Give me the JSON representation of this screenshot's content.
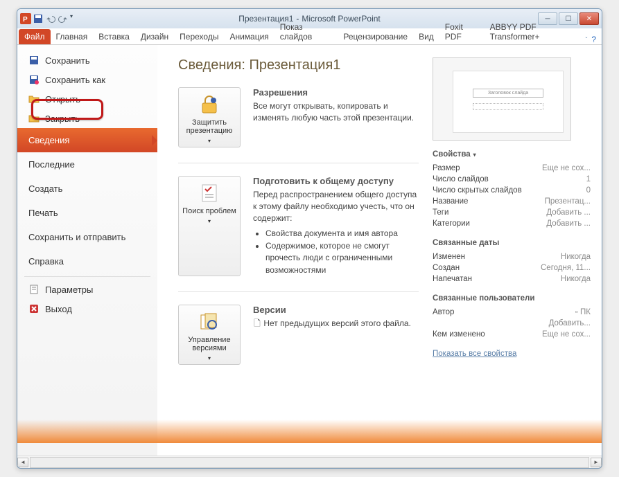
{
  "window": {
    "doc_title": "Презентация1",
    "app_title": "Microsoft PowerPoint"
  },
  "tabs": {
    "file": "Файл",
    "home": "Главная",
    "insert": "Вставка",
    "design": "Дизайн",
    "transitions": "Переходы",
    "animations": "Анимация",
    "slideshow": "Показ слайдов",
    "review": "Рецензирование",
    "view": "Вид",
    "foxit": "Foxit PDF",
    "abbyy": "ABBYY PDF Transformer+"
  },
  "sidebar": {
    "save": "Сохранить",
    "save_as": "Сохранить как",
    "open": "Открыть",
    "close": "Закрыть",
    "info": "Сведения",
    "recent": "Последние",
    "new": "Создать",
    "print": "Печать",
    "share": "Сохранить и отправить",
    "help": "Справка",
    "options": "Параметры",
    "exit": "Выход"
  },
  "info": {
    "title_prefix": "Сведения: ",
    "title_doc": "Презентация1",
    "protect_btn": "Защитить презентацию",
    "perm_h": "Разрешения",
    "perm_body": "Все могут открывать, копировать и изменять любую часть этой презентации.",
    "issues_btn": "Поиск проблем",
    "prep_h": "Подготовить к общему доступу",
    "prep_body": "Перед распространением общего доступа к этому файлу необходимо учесть, что он содержит:",
    "prep_li1": "Свойства документа и имя автора",
    "prep_li2": "Содержимое, которое не смогут прочесть люди с ограниченными возможностями",
    "versions_btn": "Управление версиями",
    "ver_h": "Версии",
    "ver_body": "Нет предыдущих версий этого файла."
  },
  "props": {
    "head": "Свойства",
    "size_k": "Размер",
    "size_v": "Еще не сох...",
    "slides_k": "Число слайдов",
    "slides_v": "1",
    "hidden_k": "Число скрытых слайдов",
    "hidden_v": "0",
    "title_k": "Название",
    "title_v": "Презентац...",
    "tags_k": "Теги",
    "tags_v": "Добавить ...",
    "cat_k": "Категории",
    "cat_v": "Добавить ...",
    "dates_head": "Связанные даты",
    "mod_k": "Изменен",
    "mod_v": "Никогда",
    "created_k": "Создан",
    "created_v": "Сегодня, 11...",
    "printed_k": "Напечатан",
    "printed_v": "Никогда",
    "users_head": "Связанные пользователи",
    "author_k": "Автор",
    "author_v": "ПК",
    "author_add": "Добавить...",
    "lastmod_k": "Кем изменено",
    "lastmod_v": "Еще не сох...",
    "show_all": "Показать все свойства"
  },
  "thumb": {
    "placeholder": "Заголовок слайда"
  }
}
